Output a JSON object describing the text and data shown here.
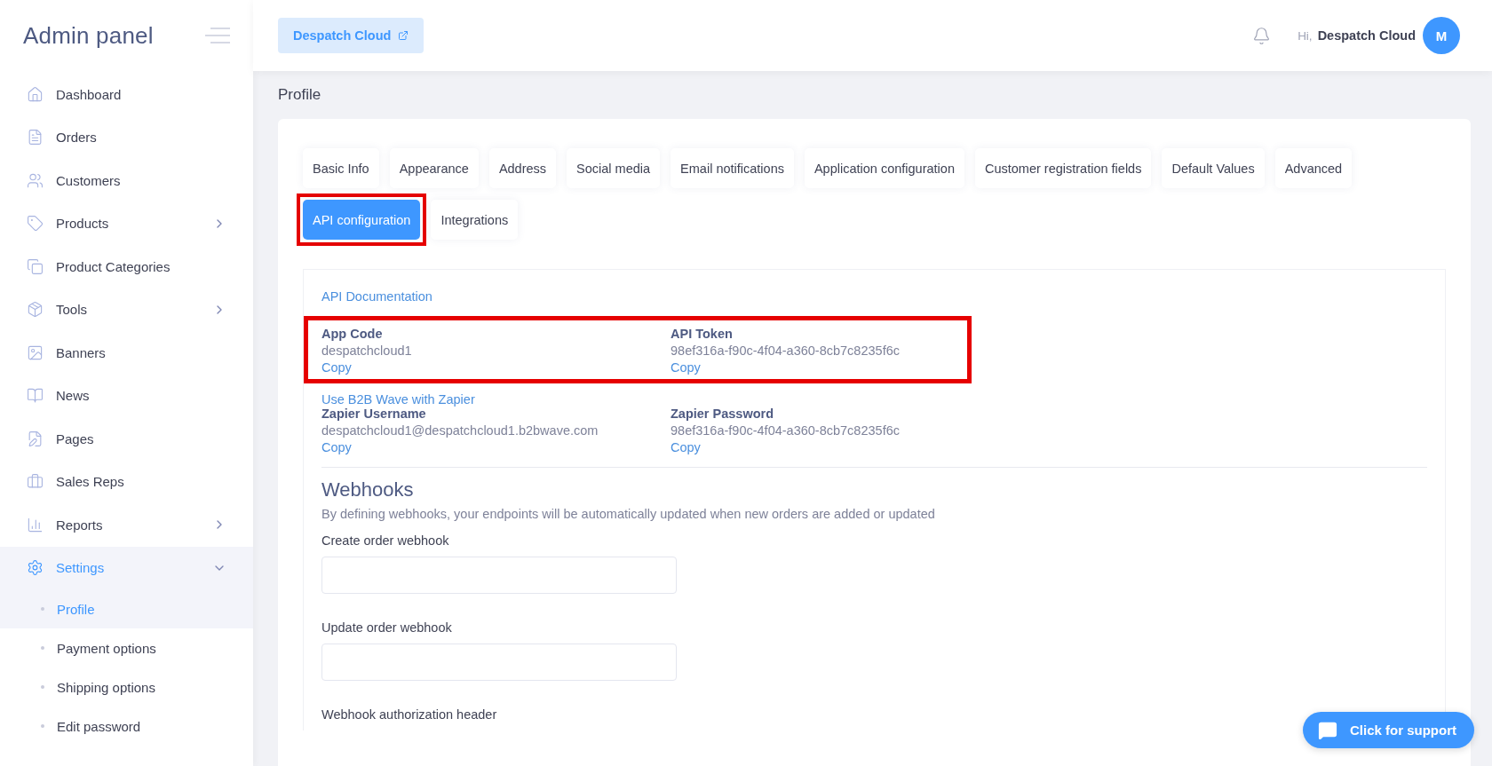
{
  "sidebar": {
    "title": "Admin panel",
    "items": [
      {
        "label": "Dashboard",
        "kind": "link",
        "selected": false
      },
      {
        "label": "Orders",
        "kind": "link",
        "selected": false
      },
      {
        "label": "Customers",
        "kind": "link",
        "selected": false
      },
      {
        "label": "Products",
        "kind": "group",
        "expanded": false,
        "selected": false
      },
      {
        "label": "Product Categories",
        "kind": "link",
        "selected": false
      },
      {
        "label": "Tools",
        "kind": "group",
        "expanded": false,
        "selected": false
      },
      {
        "label": "Banners",
        "kind": "link",
        "selected": false
      },
      {
        "label": "News",
        "kind": "link",
        "selected": false
      },
      {
        "label": "Pages",
        "kind": "link",
        "selected": false
      },
      {
        "label": "Sales Reps",
        "kind": "link",
        "selected": false
      },
      {
        "label": "Reports",
        "kind": "group",
        "expanded": false,
        "selected": false
      },
      {
        "label": "Settings",
        "kind": "group",
        "expanded": true,
        "selected": true,
        "children": [
          {
            "label": "Profile",
            "selected": true
          },
          {
            "label": "Payment options",
            "selected": false
          },
          {
            "label": "Shipping options",
            "selected": false
          },
          {
            "label": "Edit password",
            "selected": false
          }
        ]
      }
    ]
  },
  "header": {
    "store_button": "Despatch Cloud",
    "greeting": "Hi,",
    "user_name": "Despatch Cloud",
    "avatar": "M"
  },
  "page_title": "Profile",
  "tabs": [
    {
      "label": "Basic Info",
      "selected": false,
      "highlighted": false
    },
    {
      "label": "Appearance",
      "selected": false,
      "highlighted": false
    },
    {
      "label": "Address",
      "selected": false,
      "highlighted": false
    },
    {
      "label": "Social media",
      "selected": false,
      "highlighted": false
    },
    {
      "label": "Email notifications",
      "selected": false,
      "highlighted": false
    },
    {
      "label": "Application configuration",
      "selected": false,
      "highlighted": false
    },
    {
      "label": "Customer registration fields",
      "selected": false,
      "highlighted": false
    },
    {
      "label": "Default Values",
      "selected": false,
      "highlighted": false
    },
    {
      "label": "Advanced",
      "selected": false,
      "highlighted": false
    },
    {
      "label": "API configuration",
      "selected": true,
      "highlighted": true
    },
    {
      "label": "Integrations",
      "selected": false,
      "highlighted": false
    }
  ],
  "api": {
    "doc_link": "API Documentation",
    "credentials": {
      "highlighted": true,
      "fields": [
        {
          "label": "App Code",
          "value": "despatchcloud1",
          "action": "Copy"
        },
        {
          "label": "API Token",
          "value": "98ef316a-f90c-4f04-a360-8cb7c8235f6c",
          "action": "Copy"
        }
      ]
    },
    "zapier": {
      "link": "Use B2B Wave with Zapier",
      "fields": [
        {
          "label": "Zapier Username",
          "value": "despatchcloud1@despatchcloud1.b2bwave.com",
          "action": "Copy"
        },
        {
          "label": "Zapier Password",
          "value": "98ef316a-f90c-4f04-a360-8cb7c8235f6c",
          "action": "Copy"
        }
      ]
    }
  },
  "webhooks": {
    "title": "Webhooks",
    "description": "By defining webhooks, your endpoints will be automatically updated when new orders are added or updated",
    "fields": [
      {
        "label": "Create order webhook",
        "kind": "input"
      },
      {
        "label": "Update order webhook",
        "kind": "input"
      },
      {
        "label": "Webhook authorization header",
        "kind": "label"
      }
    ]
  },
  "support_button": "Click for support"
}
